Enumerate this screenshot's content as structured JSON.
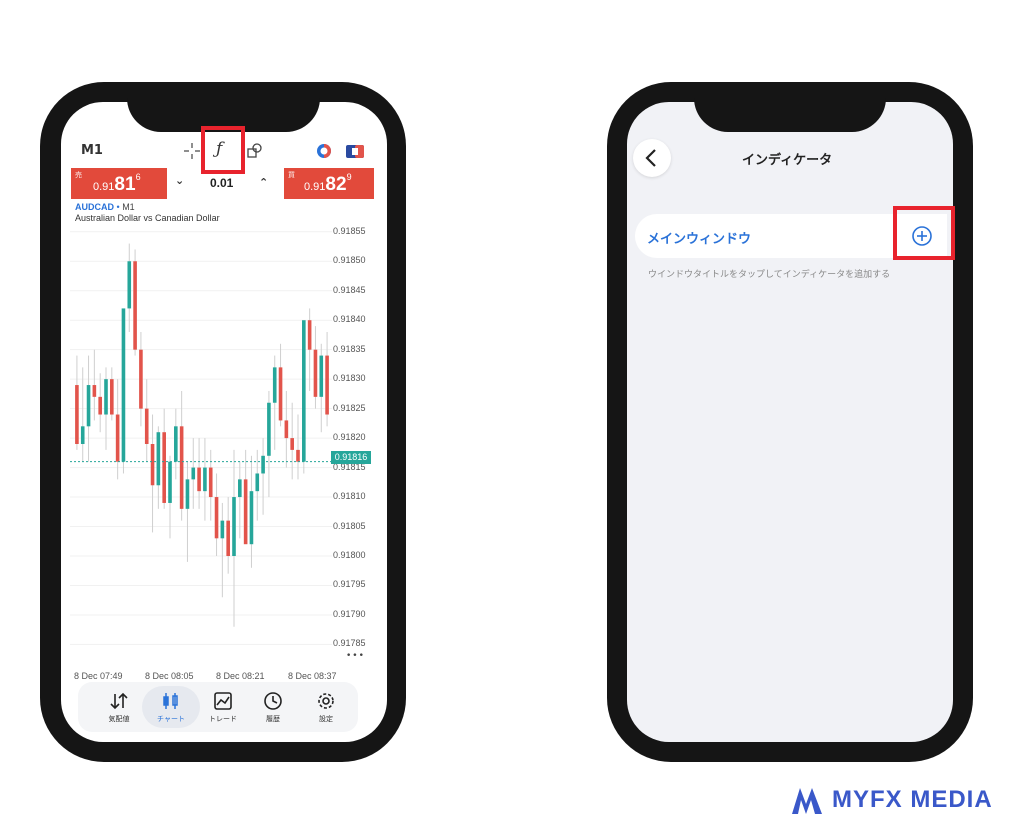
{
  "left_screen": {
    "timeframe": "M1",
    "toolbar": {
      "crosshair_icon": "crosshair-icon",
      "indicator_icon": "function-icon",
      "objects_icon": "shapes-icon",
      "right_icons": [
        "indicator-circle-icon",
        "currency-flag-icon"
      ]
    },
    "trade_panel": {
      "sell_label": "売",
      "sell_price_prefix": "0.91",
      "sell_price_big": "81",
      "sell_price_sup": "6",
      "volume": "0.01",
      "buy_label": "買",
      "buy_price_prefix": "0.91",
      "buy_price_big": "82",
      "buy_price_sup": "9"
    },
    "chart_header": {
      "symbol": "AUDCAD",
      "dot": "•",
      "timeframe": "M1",
      "description": "Australian Dollar vs Canadian Dollar"
    },
    "more_label": "•••",
    "bottom_nav": [
      {
        "icon": "quotes-arrows-icon",
        "label": "気配値"
      },
      {
        "icon": "candlestick-icon",
        "label": "チャート"
      },
      {
        "icon": "trade-chart-icon",
        "label": "トレード"
      },
      {
        "icon": "history-clock-icon",
        "label": "履歴"
      },
      {
        "icon": "settings-gear-icon",
        "label": "設定"
      }
    ]
  },
  "chart_data": {
    "type": "candlestick",
    "title": "AUDCAD • M1",
    "subtitle": "Australian Dollar vs Canadian Dollar",
    "ylim": [
      0.91781,
      0.91857
    ],
    "y_ticks": [
      "0.91855",
      "0.91850",
      "0.91845",
      "0.91840",
      "0.91835",
      "0.91830",
      "0.91825",
      "0.91820",
      "0.91815",
      "0.91810",
      "0.91805",
      "0.91800",
      "0.91795",
      "0.91790",
      "0.91785"
    ],
    "x_ticks": [
      "8 Dec 07:49",
      "8 Dec 08:05",
      "8 Dec 08:21",
      "8 Dec 08:37"
    ],
    "current_price": "0.91816",
    "colors": {
      "bull": "#26a69a",
      "bear": "#e2544b",
      "current_line": "#26a69a"
    },
    "candles": [
      {
        "o": 0.91829,
        "h": 0.91834,
        "l": 0.91818,
        "c": 0.91819
      },
      {
        "o": 0.91819,
        "h": 0.91832,
        "l": 0.91816,
        "c": 0.91822
      },
      {
        "o": 0.91822,
        "h": 0.91834,
        "l": 0.91816,
        "c": 0.91829
      },
      {
        "o": 0.91829,
        "h": 0.91835,
        "l": 0.91823,
        "c": 0.91827
      },
      {
        "o": 0.91827,
        "h": 0.91831,
        "l": 0.91821,
        "c": 0.91824
      },
      {
        "o": 0.91824,
        "h": 0.91832,
        "l": 0.91818,
        "c": 0.9183
      },
      {
        "o": 0.9183,
        "h": 0.91832,
        "l": 0.91823,
        "c": 0.91824
      },
      {
        "o": 0.91824,
        "h": 0.9183,
        "l": 0.91813,
        "c": 0.91816
      },
      {
        "o": 0.91816,
        "h": 0.91835,
        "l": 0.91814,
        "c": 0.91842
      },
      {
        "o": 0.91842,
        "h": 0.91853,
        "l": 0.91838,
        "c": 0.9185
      },
      {
        "o": 0.9185,
        "h": 0.91852,
        "l": 0.91834,
        "c": 0.91835
      },
      {
        "o": 0.91835,
        "h": 0.91838,
        "l": 0.91822,
        "c": 0.91825
      },
      {
        "o": 0.91825,
        "h": 0.9183,
        "l": 0.91816,
        "c": 0.91819
      },
      {
        "o": 0.91819,
        "h": 0.91824,
        "l": 0.91804,
        "c": 0.91812
      },
      {
        "o": 0.91812,
        "h": 0.91822,
        "l": 0.91808,
        "c": 0.91821
      },
      {
        "o": 0.91821,
        "h": 0.91825,
        "l": 0.91808,
        "c": 0.91809
      },
      {
        "o": 0.91809,
        "h": 0.91817,
        "l": 0.91803,
        "c": 0.91816
      },
      {
        "o": 0.91816,
        "h": 0.91825,
        "l": 0.91813,
        "c": 0.91822
      },
      {
        "o": 0.91822,
        "h": 0.91828,
        "l": 0.91806,
        "c": 0.91808
      },
      {
        "o": 0.91808,
        "h": 0.91816,
        "l": 0.91799,
        "c": 0.91813
      },
      {
        "o": 0.91813,
        "h": 0.9182,
        "l": 0.91808,
        "c": 0.91815
      },
      {
        "o": 0.91815,
        "h": 0.9182,
        "l": 0.91808,
        "c": 0.91811
      },
      {
        "o": 0.91811,
        "h": 0.9182,
        "l": 0.91806,
        "c": 0.91815
      },
      {
        "o": 0.91815,
        "h": 0.91818,
        "l": 0.91806,
        "c": 0.9181
      },
      {
        "o": 0.9181,
        "h": 0.91814,
        "l": 0.918,
        "c": 0.91803
      },
      {
        "o": 0.91803,
        "h": 0.91809,
        "l": 0.91793,
        "c": 0.91806
      },
      {
        "o": 0.91806,
        "h": 0.9181,
        "l": 0.91797,
        "c": 0.918
      },
      {
        "o": 0.918,
        "h": 0.91818,
        "l": 0.91788,
        "c": 0.9181
      },
      {
        "o": 0.9181,
        "h": 0.91816,
        "l": 0.91803,
        "c": 0.91813
      },
      {
        "o": 0.91813,
        "h": 0.91818,
        "l": 0.91805,
        "c": 0.91802
      },
      {
        "o": 0.91802,
        "h": 0.91817,
        "l": 0.91798,
        "c": 0.91811
      },
      {
        "o": 0.91811,
        "h": 0.91818,
        "l": 0.91806,
        "c": 0.91814
      },
      {
        "o": 0.91814,
        "h": 0.9182,
        "l": 0.91807,
        "c": 0.91817
      },
      {
        "o": 0.91817,
        "h": 0.91828,
        "l": 0.9181,
        "c": 0.91826
      },
      {
        "o": 0.91826,
        "h": 0.91834,
        "l": 0.91818,
        "c": 0.91832
      },
      {
        "o": 0.91832,
        "h": 0.91836,
        "l": 0.91822,
        "c": 0.91823
      },
      {
        "o": 0.91823,
        "h": 0.91828,
        "l": 0.91815,
        "c": 0.9182
      },
      {
        "o": 0.9182,
        "h": 0.91826,
        "l": 0.91813,
        "c": 0.91818
      },
      {
        "o": 0.91818,
        "h": 0.91824,
        "l": 0.91813,
        "c": 0.91816
      },
      {
        "o": 0.91816,
        "h": 0.91837,
        "l": 0.91814,
        "c": 0.9184
      },
      {
        "o": 0.9184,
        "h": 0.91842,
        "l": 0.91828,
        "c": 0.91835
      },
      {
        "o": 0.91835,
        "h": 0.91839,
        "l": 0.91825,
        "c": 0.91827
      },
      {
        "o": 0.91827,
        "h": 0.91836,
        "l": 0.91821,
        "c": 0.91834
      },
      {
        "o": 0.91834,
        "h": 0.91838,
        "l": 0.91822,
        "c": 0.91824
      }
    ]
  },
  "right_screen": {
    "title": "インディケータ",
    "back_icon": "chevron-left-icon",
    "main_window_label": "メインウィンドウ",
    "add_icon": "plus-circle-icon",
    "hint": "ウインドウタイトルをタップしてインディケータを追加する"
  },
  "brand": {
    "logo_icon": "myfx-logo-icon",
    "name": "MYFX MEDIA",
    "color": "#3a58c9"
  },
  "colors": {
    "highlight": "#e8232d",
    "accent": "#2a72d8",
    "sell": "#e24a3b"
  }
}
